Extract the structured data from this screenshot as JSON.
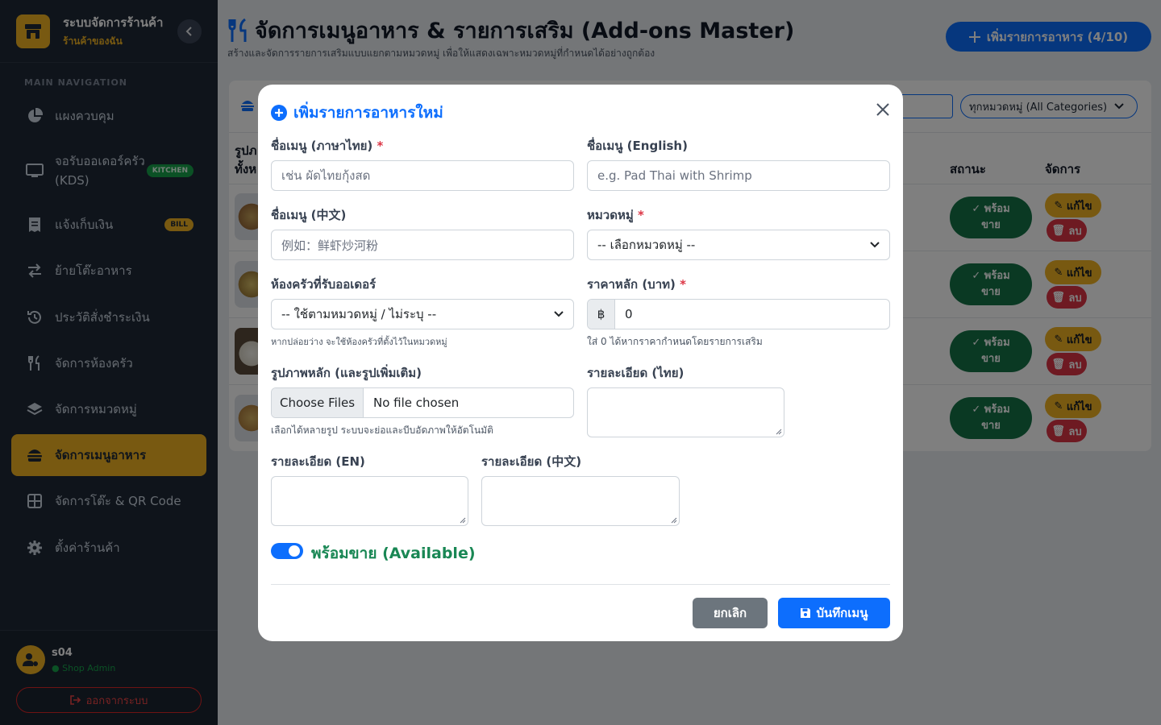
{
  "brand": {
    "title": "ระบบจัดการร้านค้า",
    "subtitle": "ร้านค้าของฉัน"
  },
  "nav": {
    "heading": "MAIN NAVIGATION",
    "items": [
      {
        "label": "แผงควบคุม",
        "icon": "pie-chart-icon"
      },
      {
        "label": "จอรับออเดอร์ครัว (KDS)",
        "icon": "monitor-icon",
        "badge": "KITCHEN"
      },
      {
        "label": "แจ้งเก็บเงิน",
        "icon": "receipt-icon",
        "badge": "BILL"
      },
      {
        "label": "ย้ายโต๊ะอาหาร",
        "icon": "swap-icon"
      },
      {
        "label": "ประวัติสั่งชำระเงิน",
        "icon": "history-icon"
      },
      {
        "label": "จัดการห้องครัว",
        "icon": "utensils-icon"
      },
      {
        "label": "จัดการหมวดหมู่",
        "icon": "layers-icon"
      },
      {
        "label": "จัดการเมนูอาหาร",
        "icon": "burger-icon",
        "active": true
      },
      {
        "label": "จัดการโต๊ะ & QR Code",
        "icon": "grid-icon"
      },
      {
        "label": "ตั้งค่าร้านค้า",
        "icon": "gear-icon"
      }
    ]
  },
  "user": {
    "name": "s04",
    "role": "Shop Admin",
    "logout": "ออกจากระบบ"
  },
  "header": {
    "title": "จัดการเมนูอาหาร & รายการเสริม (Add-ons Master)",
    "subtitle": "สร้างและจัดการรายการเสริมแบบแยกตามหมวดหมู่ เพื่อให้แสดงเฉพาะหมวดหมู่ที่กำหนดได้อย่างถูกต้อง",
    "add_button": "เพิ่มรายการอาหาร (4/10)"
  },
  "table": {
    "filter": "ทุกหมวดหมู่ (All Categories)",
    "col_image_1": "รูปภ",
    "col_image_2": "ทั้งห",
    "col_status": "สถานะ",
    "col_actions": "จัดการ",
    "rows": [
      {
        "status": "พร้อม\nขาย",
        "edit": "แก้ไข",
        "delete": "ลบ"
      },
      {
        "status": "พร้อม\nขาย",
        "edit": "แก้ไข",
        "delete": "ลบ"
      },
      {
        "status": "พร้อม\nขาย",
        "edit": "แก้ไข",
        "delete": "ลบ"
      },
      {
        "status": "พร้อม\nขาย",
        "edit": "แก้ไข",
        "delete": "ลบ"
      }
    ]
  },
  "modal": {
    "title": "เพิ่มรายการอาหารใหม่",
    "name_th": {
      "label": "ชื่อเมนู (ภาษาไทย)",
      "placeholder": "เช่น ผัดไทยกุ้งสด"
    },
    "name_en": {
      "label": "ชื่อเมนู (English)",
      "placeholder": "e.g. Pad Thai with Shrimp"
    },
    "name_cn": {
      "label": "ชื่อเมนู (中文)",
      "placeholder": "例如：鲜虾炒河粉"
    },
    "category": {
      "label": "หมวดหมู่",
      "value": "-- เลือกหมวดหมู่ --"
    },
    "kitchen": {
      "label": "ห้องครัวที่รับออเดอร์",
      "value": "-- ใช้ตามหมวดหมู่ / ไม่ระบุ --",
      "hint": "หากปล่อยว่าง จะใช้ห้องครัวที่ตั้งไว้ในหมวดหมู่"
    },
    "price": {
      "label": "ราคาหลัก (บาท)",
      "currency": "฿",
      "value": "0",
      "hint": "ใส่ 0 ได้หากราคากำหนดโดยรายการเสริม"
    },
    "image": {
      "label": "รูปภาพหลัก (และรูปเพิ่มเติม)",
      "button": "Choose Files",
      "status": "No file chosen",
      "hint": "เลือกได้หลายรูป ระบบจะย่อและบีบอัดภาพให้อัตโนมัติ"
    },
    "desc_th": {
      "label": "รายละเอียด (ไทย)"
    },
    "desc_en": {
      "label": "รายละเอียด (EN)"
    },
    "desc_cn": {
      "label": "รายละเอียด (中文)"
    },
    "available": {
      "label": "พร้อมขาย (Available)",
      "checked": true
    },
    "cancel": "ยกเลิก",
    "save": "บันทึกเมนู"
  },
  "colors": {
    "primary": "#0d6efd",
    "accent": "#f0b323",
    "sidebar": "#1f2937",
    "success": "#157347",
    "danger": "#dc3545"
  }
}
